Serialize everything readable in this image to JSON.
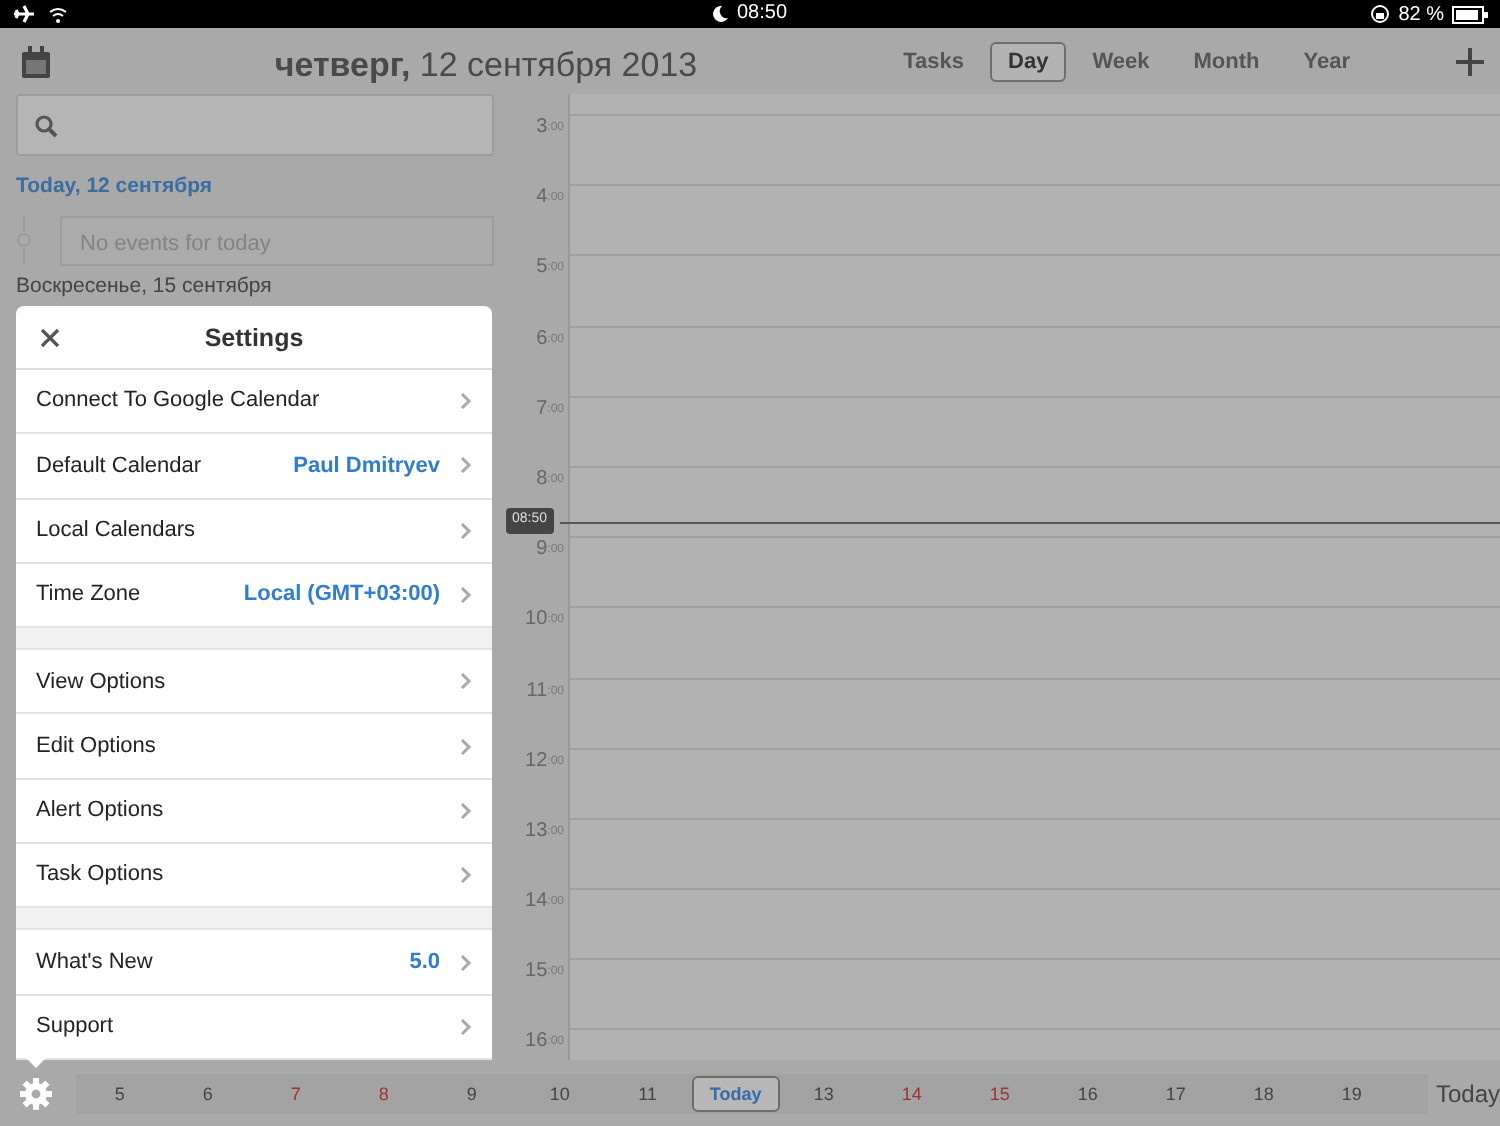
{
  "status_bar": {
    "time": "08:50",
    "battery": "82 %"
  },
  "header": {
    "title": "**четверг,** 12 сентября 2013"
  },
  "view_tabs": [
    {
      "label": "Tasks",
      "selected": false
    },
    {
      "label": "Day",
      "selected": true
    },
    {
      "label": "Week",
      "selected": false
    },
    {
      "label": "Month",
      "selected": false
    },
    {
      "label": "Year",
      "selected": false
    }
  ],
  "agenda": {
    "today_heading": "Today, 12 сентября",
    "empty_message": "No events for today",
    "next_heading": "Воскресенье, 15 сентября"
  },
  "settings": {
    "title": "Settings",
    "groups": [
      [
        {
          "label": "Connect To Google Calendar"
        },
        {
          "label": "Default Calendar",
          "value": "Paul Dmitryev"
        },
        {
          "label": "Local Calendars"
        },
        {
          "label": "Time Zone",
          "value": "Local (GMT+03:00)"
        }
      ],
      [
        {
          "label": "View Options"
        },
        {
          "label": "Edit Options"
        },
        {
          "label": "Alert Options"
        },
        {
          "label": "Task Options"
        }
      ],
      [
        {
          "label": "What's New",
          "value": "5.0"
        },
        {
          "label": "Support"
        }
      ]
    ]
  },
  "day_view": {
    "hours": [
      {
        "hour": "3",
        "minutes": ":00"
      },
      {
        "hour": "4",
        "minutes": ":00"
      },
      {
        "hour": "5",
        "minutes": ":00"
      },
      {
        "hour": "6",
        "minutes": ":00"
      },
      {
        "hour": "7",
        "minutes": ":00"
      },
      {
        "hour": "8",
        "minutes": ":00"
      },
      {
        "hour": "9",
        "minutes": ":00"
      },
      {
        "hour": "10",
        "minutes": ":00"
      },
      {
        "hour": "11",
        "minutes": ":00"
      },
      {
        "hour": "12",
        "minutes": ":00"
      },
      {
        "hour": "13",
        "minutes": ":00"
      },
      {
        "hour": "14",
        "minutes": ":00"
      },
      {
        "hour": "15",
        "minutes": ":00"
      },
      {
        "hour": "16",
        "minutes": ":00"
      }
    ],
    "now_label": "08:50"
  },
  "date_strip": [
    {
      "label": "5",
      "weekend": false,
      "selected": false
    },
    {
      "label": "6",
      "weekend": false,
      "selected": false
    },
    {
      "label": "7",
      "weekend": true,
      "selected": false
    },
    {
      "label": "8",
      "weekend": true,
      "selected": false
    },
    {
      "label": "9",
      "weekend": false,
      "selected": false
    },
    {
      "label": "10",
      "weekend": false,
      "selected": false
    },
    {
      "label": "11",
      "weekend": false,
      "selected": false
    },
    {
      "label": "Today",
      "weekend": false,
      "selected": true
    },
    {
      "label": "13",
      "weekend": false,
      "selected": false
    },
    {
      "label": "14",
      "weekend": true,
      "selected": false
    },
    {
      "label": "15",
      "weekend": true,
      "selected": false
    },
    {
      "label": "16",
      "weekend": false,
      "selected": false
    },
    {
      "label": "17",
      "weekend": false,
      "selected": false
    },
    {
      "label": "18",
      "weekend": false,
      "selected": false
    },
    {
      "label": "19",
      "weekend": false,
      "selected": false
    }
  ],
  "today_button": "Today"
}
